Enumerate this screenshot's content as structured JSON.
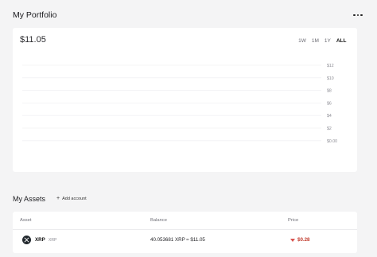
{
  "header": {
    "title": "My Portfolio",
    "more_icon": "more-horizontal-icon"
  },
  "portfolio": {
    "balance": "$11.05",
    "timeframes": [
      {
        "label": "1W",
        "active": false
      },
      {
        "label": "1M",
        "active": false
      },
      {
        "label": "1Y",
        "active": false
      },
      {
        "label": "ALL",
        "active": true
      }
    ],
    "y_ticks": [
      "$12",
      "$10",
      "$8",
      "$6",
      "$4",
      "$2",
      "$0.00"
    ]
  },
  "assets": {
    "title": "My Assets",
    "add_account_label": "Add account",
    "columns": {
      "asset": "Asset",
      "balance": "Balance",
      "price": "Price"
    },
    "rows": [
      {
        "symbol": "XRP",
        "name": "XRP",
        "balance": "40.053681 XRP ≈ $11.05",
        "price": "$0.28",
        "trend": "down",
        "icon": "xrp-icon"
      }
    ]
  },
  "colors": {
    "background": "#f4f4f5",
    "card": "#ffffff",
    "down": "#d9534f"
  }
}
